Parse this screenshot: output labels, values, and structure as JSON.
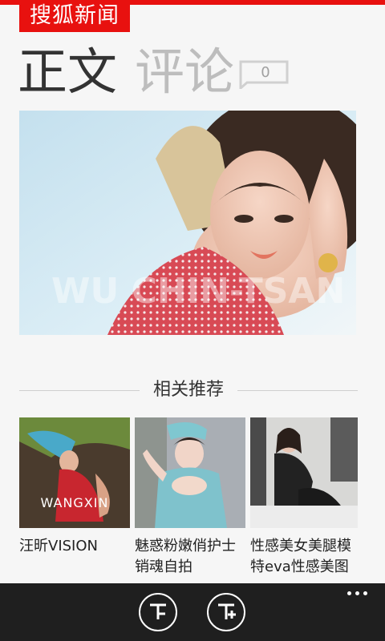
{
  "header": {
    "brand": "搜狐新闻"
  },
  "pivot": {
    "active": "正文",
    "inactive": "评论",
    "comment_count": "0"
  },
  "hero": {
    "image": "portrait-photo"
  },
  "related": {
    "title": "相关推荐",
    "items": [
      {
        "caption": "汪昕VISION",
        "logo": "WANGXIN"
      },
      {
        "caption": "魅惑粉嫩俏护士销魂自拍"
      },
      {
        "caption": "性感美女美腿模特eva性感美图"
      }
    ]
  },
  "appbar": {
    "buttons": [
      {
        "icon": "font-decrease-icon"
      },
      {
        "icon": "font-increase-icon"
      }
    ]
  }
}
